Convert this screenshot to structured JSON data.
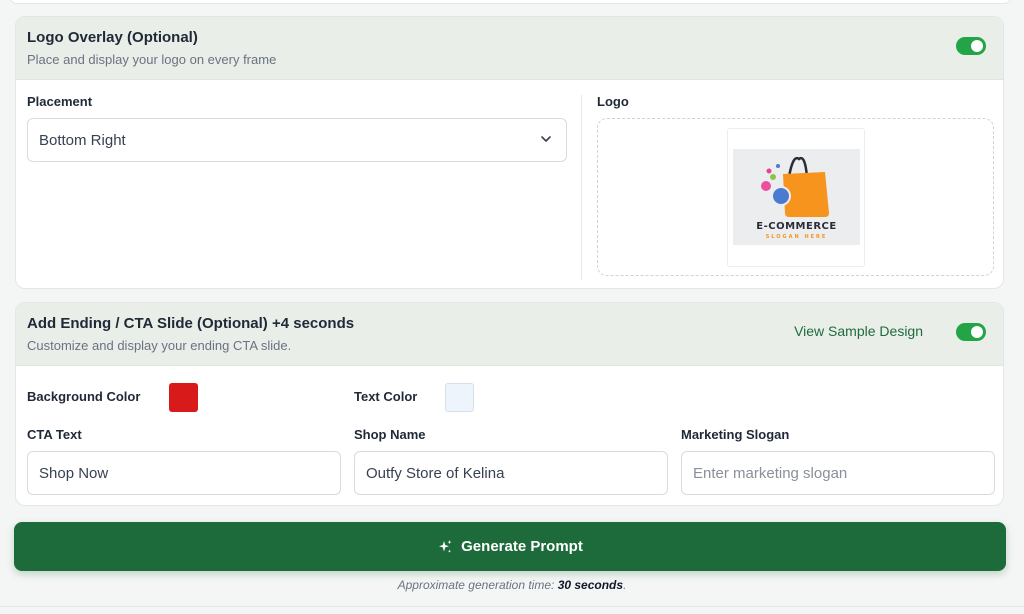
{
  "logo_overlay": {
    "title": "Logo Overlay (Optional)",
    "subtitle": "Place and display your logo on every frame",
    "enabled": true,
    "placement_label": "Placement",
    "placement_value": "Bottom Right",
    "logo_label": "Logo",
    "logo_preview": {
      "word": "E-COMMERCE",
      "slogan": "SLOGAN HERE"
    }
  },
  "cta_slide": {
    "title": "Add Ending / CTA Slide (Optional) +4 seconds",
    "subtitle": "Customize and display your ending CTA slide.",
    "enabled": true,
    "view_sample": "View Sample Design",
    "background_color_label": "Background Color",
    "background_color": "#d91a1a",
    "text_color_label": "Text Color",
    "text_color": "#eef4fb",
    "cta_text_label": "CTA Text",
    "cta_text_value": "Shop Now",
    "shop_name_label": "Shop Name",
    "shop_name_value": "Outfy Store of Kelina",
    "slogan_label": "Marketing Slogan",
    "slogan_placeholder": "Enter marketing slogan"
  },
  "generate": {
    "button_label": "Generate Prompt",
    "note_prefix": "Approximate generation time:",
    "note_time": "30 seconds",
    "note_suffix": "."
  },
  "colors": {
    "accent": "#1d6a3a",
    "toggle_on": "#22a447",
    "header_bg": "#e9eee9"
  },
  "icons": {
    "dropdown": "chevron-down-icon",
    "generate": "sparkle-icon"
  }
}
